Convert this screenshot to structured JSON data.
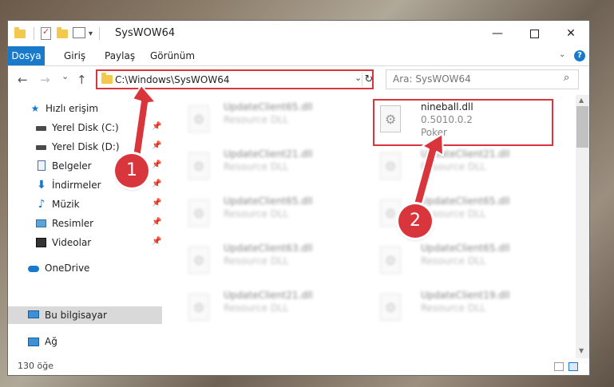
{
  "window": {
    "title": "SysWOW64",
    "quick_access_icons": [
      "folder-icon",
      "properties-check-icon",
      "new-folder-icon",
      "customize-icon"
    ],
    "quick_access_dropdown": "▾",
    "controls": {
      "minimize": "—",
      "maximize": "",
      "close": "✕"
    }
  },
  "ribbon": {
    "tabs": [
      {
        "label": "Dosya"
      },
      {
        "label": "Giriş"
      },
      {
        "label": "Paylaş"
      },
      {
        "label": "Görünüm"
      }
    ],
    "help": "?",
    "expand": "⌄"
  },
  "nav": {
    "back": "←",
    "forward": "→",
    "recent": "⌄",
    "up": "↑",
    "address": "C:\\Windows\\SysWOW64",
    "address_dropdown": "⌄",
    "refresh": "↻",
    "search_placeholder": "Ara: SysWOW64",
    "search_icon": "⌕"
  },
  "sidebar": {
    "items": [
      {
        "label": "Hızlı erişim",
        "icon": "star-icon",
        "pinned": false
      },
      {
        "label": "Yerel Disk (C:)",
        "icon": "drive-icon",
        "pinned": true
      },
      {
        "label": "Yerel Disk (D:)",
        "icon": "drive-icon",
        "pinned": true
      },
      {
        "label": "Belgeler",
        "icon": "documents-icon",
        "pinned": true
      },
      {
        "label": "İndirmeler",
        "icon": "download-icon",
        "pinned": true
      },
      {
        "label": "Müzik",
        "icon": "music-icon",
        "pinned": true
      },
      {
        "label": "Resimler",
        "icon": "pictures-icon",
        "pinned": true
      },
      {
        "label": "Videolar",
        "icon": "videos-icon",
        "pinned": true
      },
      {
        "label": "OneDrive",
        "icon": "onedrive-icon",
        "pinned": false
      },
      {
        "label": "Bu bilgisayar",
        "icon": "this-pc-icon",
        "pinned": false,
        "selected": true
      },
      {
        "label": "Ağ",
        "icon": "network-icon",
        "pinned": false
      }
    ],
    "pin_glyph": "📌"
  },
  "files": {
    "left": [
      {
        "name": "UpdateClient65.dll",
        "type": "Resource DLL"
      },
      {
        "name": "UpdateClient21.dll",
        "type": "Resource DLL"
      },
      {
        "name": "UpdateClient65.dll",
        "type": "Resource DLL"
      },
      {
        "name": "UpdateClient63.dll",
        "type": "Resource DLL"
      },
      {
        "name": "UpdateClient21.dll",
        "type": "Resource DLL"
      }
    ],
    "right": [
      {
        "name": "nineball.dll",
        "version": "0.5010.0.2",
        "description": "Poker",
        "highlighted": true
      },
      {
        "name": "UpdateClient21.dll",
        "type": "Resource DLL"
      },
      {
        "name": "UpdateClient65.dll",
        "type": "Resource DLL"
      },
      {
        "name": "UpdateClient65.dll",
        "type": "Resource DLL"
      },
      {
        "name": "UpdateClient19.dll",
        "type": "Resource DLL"
      }
    ]
  },
  "status": {
    "item_count": "130 öğe"
  },
  "annotations": {
    "badge_1": "1",
    "badge_2": "2",
    "color": "#d9353c"
  }
}
